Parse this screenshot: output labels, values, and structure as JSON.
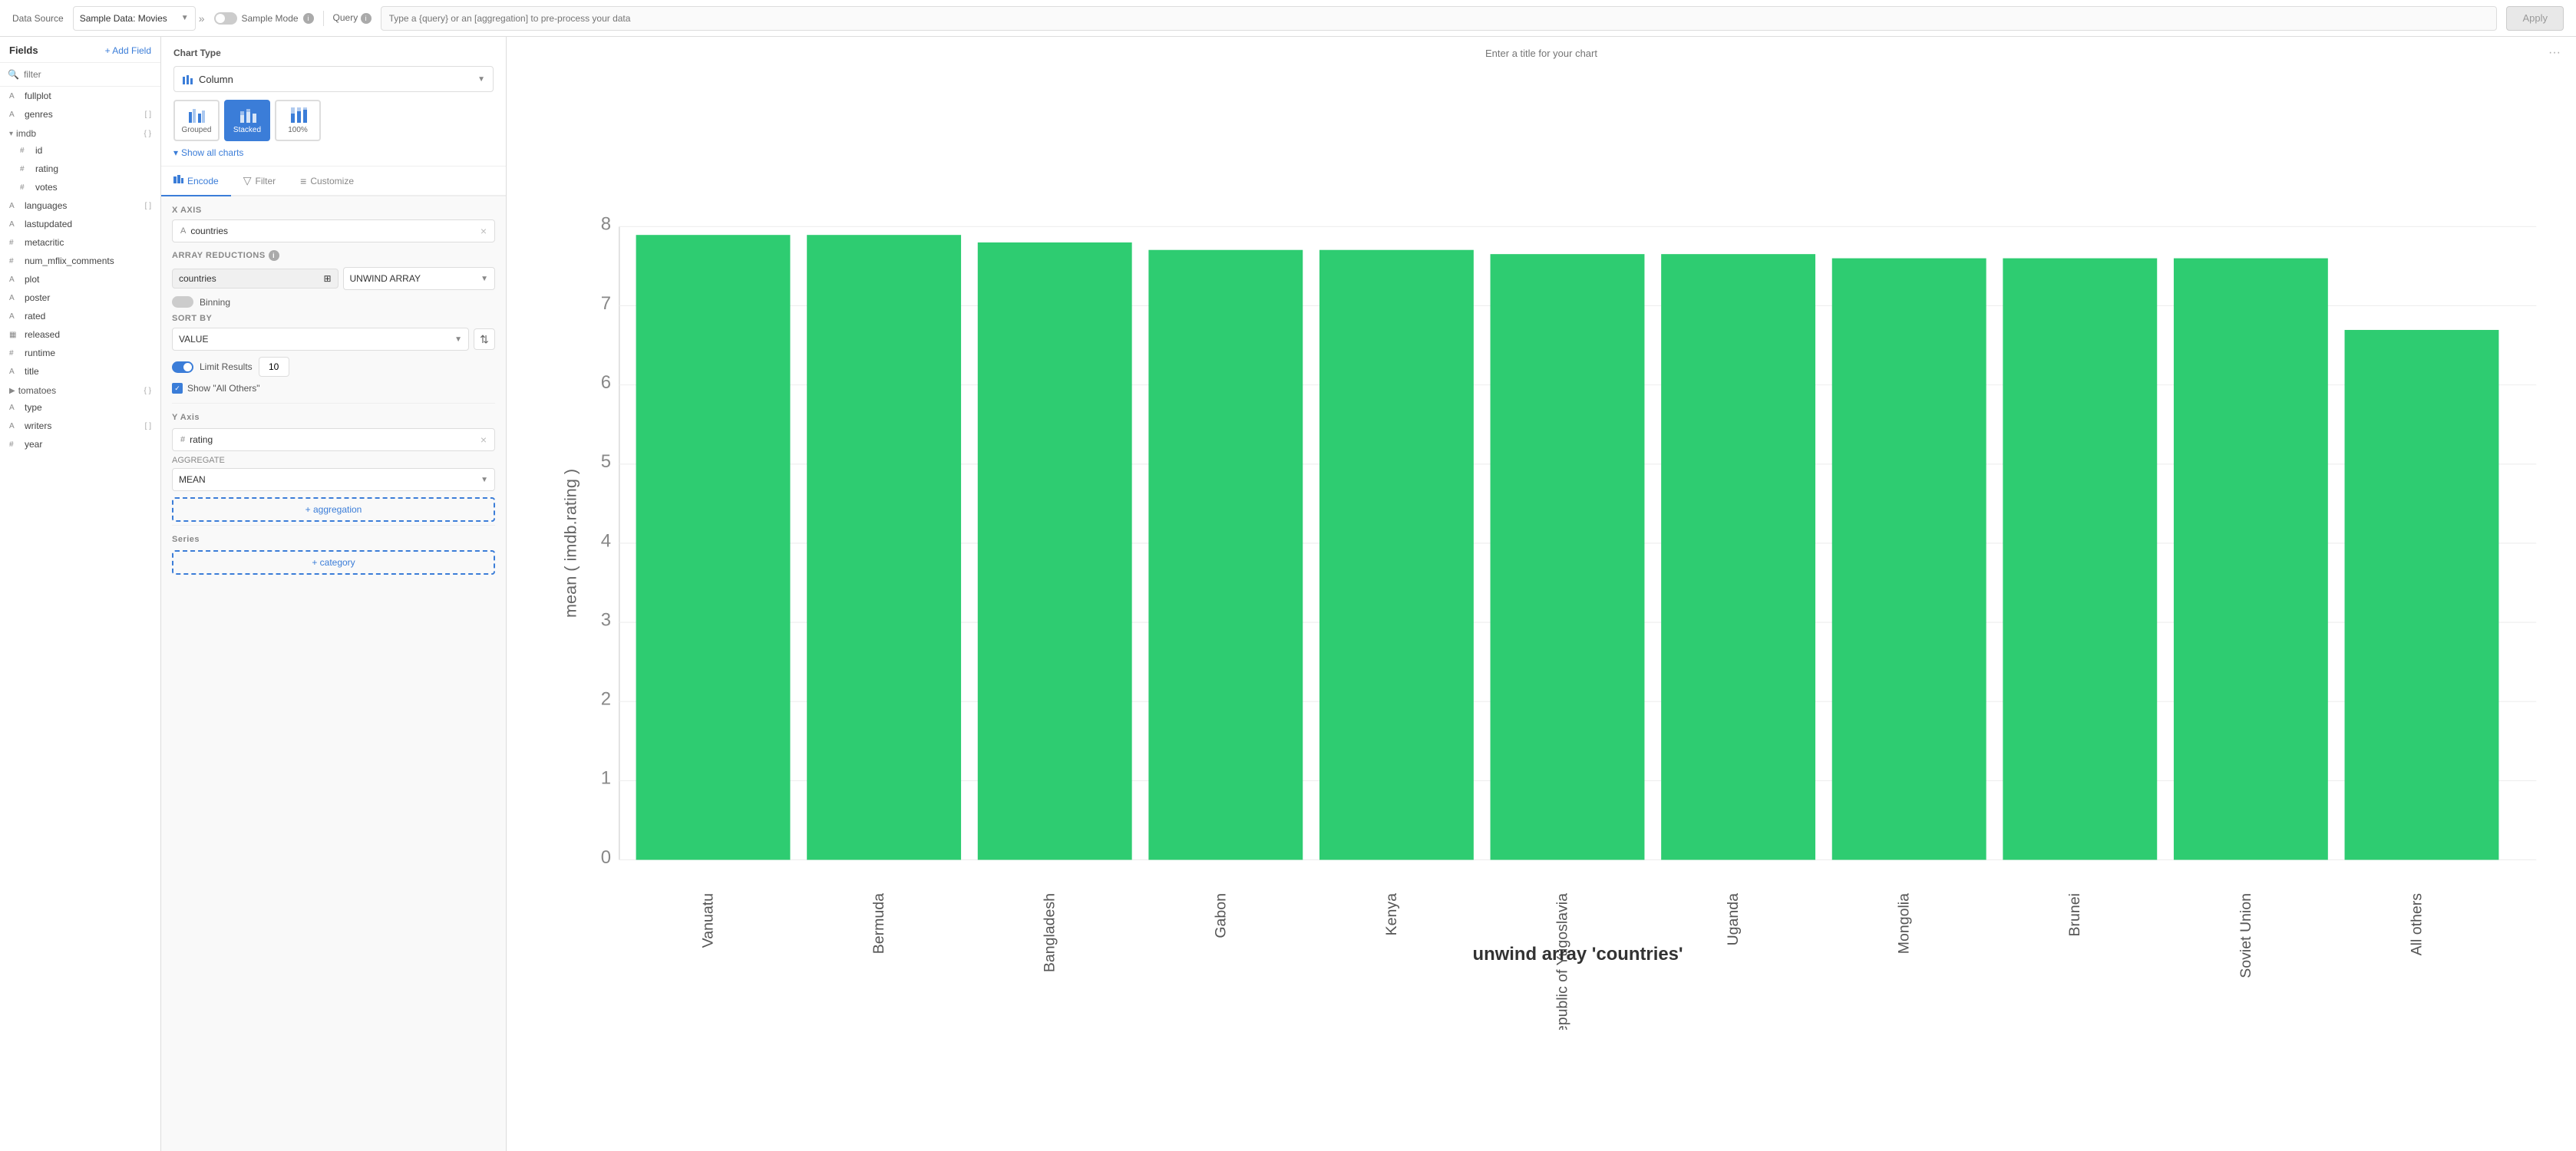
{
  "topBar": {
    "dataSourceLabel": "Data Source",
    "sampleModeLabel": "Sample Mode",
    "queryLabel": "Query",
    "queryPlaceholder": "Type a {query} or an [aggregation] to pre-process your data",
    "applyLabel": "Apply",
    "datasourceValue": "Sample Data: Movies"
  },
  "fields": {
    "title": "Fields",
    "addFieldLabel": "+ Add Field",
    "filterPlaceholder": "filter",
    "items": [
      {
        "name": "fullplot",
        "type": "string",
        "icon": "A",
        "tag": ""
      },
      {
        "name": "genres",
        "type": "array",
        "icon": "A",
        "tag": "[]"
      },
      {
        "name": "imdb",
        "type": "object",
        "icon": "{}",
        "tag": "",
        "isGroup": true,
        "children": [
          {
            "name": "id",
            "type": "number",
            "icon": "#"
          },
          {
            "name": "rating",
            "type": "number",
            "icon": "#"
          },
          {
            "name": "votes",
            "type": "number",
            "icon": "#"
          }
        ]
      },
      {
        "name": "languages",
        "type": "array",
        "icon": "A",
        "tag": "[]"
      },
      {
        "name": "lastupdated",
        "type": "string",
        "icon": "A",
        "tag": ""
      },
      {
        "name": "metacritic",
        "type": "number",
        "icon": "#",
        "tag": ""
      },
      {
        "name": "num_mflix_comments",
        "type": "number",
        "icon": "#",
        "tag": ""
      },
      {
        "name": "plot",
        "type": "string",
        "icon": "A",
        "tag": ""
      },
      {
        "name": "poster",
        "type": "string",
        "icon": "A",
        "tag": ""
      },
      {
        "name": "rated",
        "type": "string",
        "icon": "A",
        "tag": ""
      },
      {
        "name": "released",
        "type": "date",
        "icon": "▦",
        "tag": ""
      },
      {
        "name": "runtime",
        "type": "number",
        "icon": "#",
        "tag": ""
      },
      {
        "name": "title",
        "type": "string",
        "icon": "A",
        "tag": ""
      },
      {
        "name": "tomatoes",
        "type": "object",
        "icon": "{}",
        "tag": "",
        "isGroup": true
      },
      {
        "name": "type",
        "type": "string",
        "icon": "A",
        "tag": ""
      },
      {
        "name": "writers",
        "type": "array",
        "icon": "A",
        "tag": "[]"
      },
      {
        "name": "year",
        "type": "number",
        "icon": "#",
        "tag": ""
      }
    ]
  },
  "chartType": {
    "sectionTitle": "Chart Type",
    "selectedType": "Column",
    "variants": [
      {
        "id": "grouped",
        "label": "Grouped",
        "active": false
      },
      {
        "id": "stacked",
        "label": "Stacked",
        "active": true
      },
      {
        "id": "100pct",
        "label": "100%",
        "active": false
      }
    ],
    "showAllChartsLabel": "Show all charts"
  },
  "encodeTabs": [
    {
      "id": "encode",
      "label": "Encode",
      "active": true,
      "icon": "▦"
    },
    {
      "id": "filter",
      "label": "Filter",
      "active": false,
      "icon": "▽"
    },
    {
      "id": "customize",
      "label": "Customize",
      "active": false,
      "icon": "≡"
    }
  ],
  "xAxis": {
    "fieldLabel": "X AXIS",
    "fieldName": "countries",
    "fieldIcon": "A",
    "arrayReductionsLabel": "ARRAY REDUCTIONS",
    "reductionFieldName": "countries",
    "reductionType": "UNWIND ARRAY",
    "binningLabel": "Binning",
    "sortByLabel": "SORT BY",
    "sortByValue": "VALUE",
    "limitLabel": "Limit Results",
    "limitValue": "10",
    "showOthersLabel": "Show \"All Others\""
  },
  "yAxis": {
    "sectionTitle": "Y Axis",
    "fieldName": "rating",
    "fieldIcon": "#",
    "aggregateLabel": "AGGREGATE",
    "aggregateValue": "MEAN",
    "addAggregationLabel": "+ aggregation"
  },
  "series": {
    "sectionTitle": "Series",
    "addCategoryLabel": "+ category"
  },
  "chart": {
    "titlePlaceholder": "Enter a title for your chart",
    "xAxisLabel": "unwind array 'countries'",
    "yAxisLabel": "mean ( imdb.rating )",
    "optionsIcon": "...",
    "bars": [
      {
        "country": "Vanuatu",
        "value": 7.9
      },
      {
        "country": "Bermuda",
        "value": 7.9
      },
      {
        "country": "Bangladesh",
        "value": 7.8
      },
      {
        "country": "Gabon",
        "value": 7.7
      },
      {
        "country": "Kenya",
        "value": 7.7
      },
      {
        "country": "Federal Republic of Yugoslavia",
        "value": 7.65
      },
      {
        "country": "Uganda",
        "value": 7.65
      },
      {
        "country": "Mongolia",
        "value": 7.6
      },
      {
        "country": "Brunei",
        "value": 7.6
      },
      {
        "country": "Soviet Union",
        "value": 7.6
      },
      {
        "country": "All others",
        "value": 6.7
      }
    ],
    "yAxisTicks": [
      0,
      1,
      2,
      3,
      4,
      5,
      6,
      7,
      8
    ],
    "yMax": 8
  }
}
